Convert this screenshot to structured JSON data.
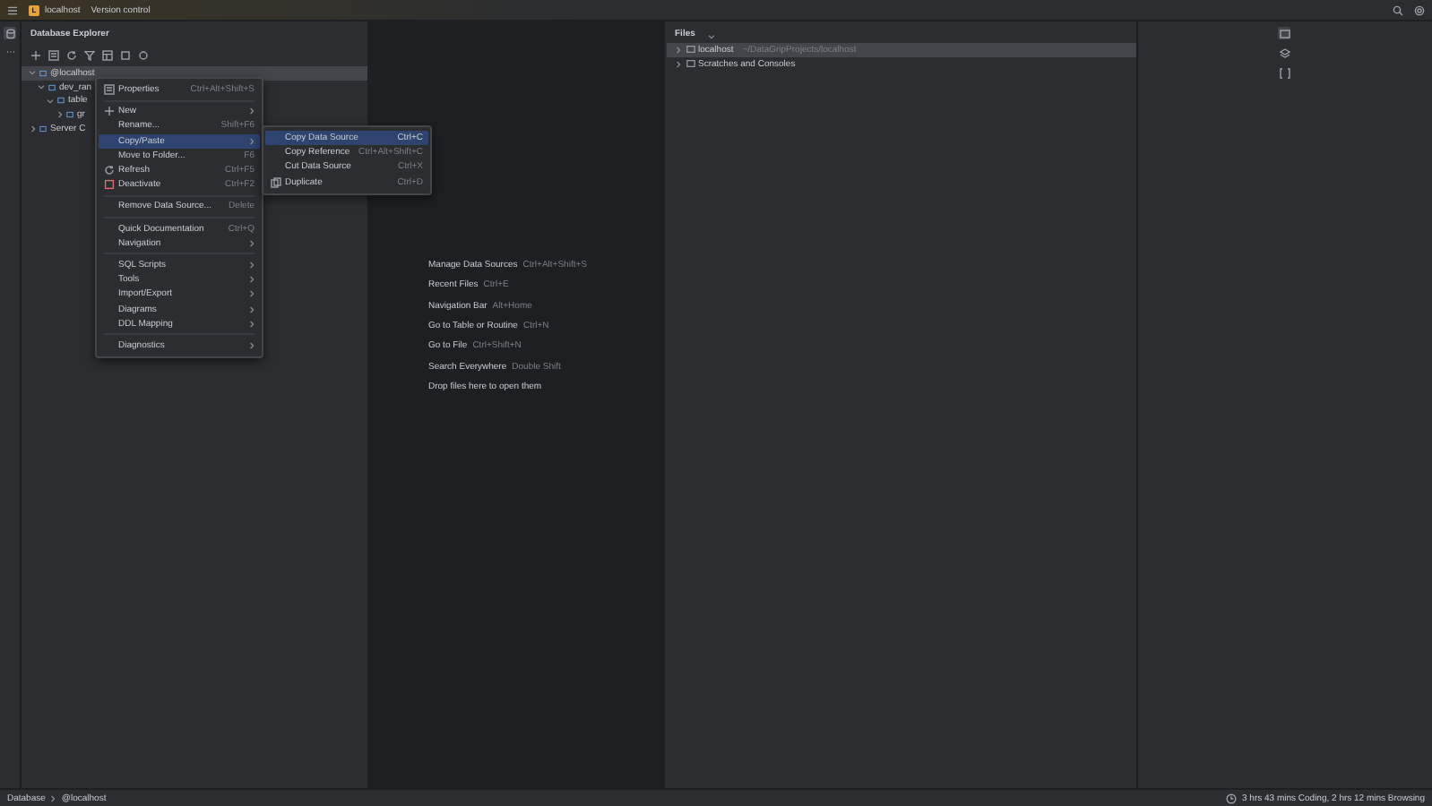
{
  "title_bar": {
    "project_badge": "L",
    "project": "localhost",
    "vcs": "Version control"
  },
  "explorer": {
    "title": "Database Explorer",
    "tree": [
      {
        "label": "@localhost",
        "selected": true,
        "expanded": true,
        "children": [
          {
            "label": "dev_ran",
            "selected": false,
            "expanded": true,
            "children": [
              {
                "label": "table",
                "selected": false,
                "expanded": true,
                "children": [
                  {
                    "label": "gr",
                    "selected": false,
                    "expanded": false
                  }
                ]
              }
            ]
          }
        ]
      },
      {
        "label": "Server C",
        "selected": false,
        "expanded": false
      }
    ]
  },
  "context_menu": [
    {
      "kind": "item",
      "label": "Properties",
      "shortcut": "Ctrl+Alt+Shift+S",
      "submenu": false,
      "selected": false
    },
    {
      "kind": "separator"
    },
    {
      "kind": "item",
      "label": "New",
      "submenu": true,
      "selected": false
    },
    {
      "kind": "item",
      "label": "Rename...",
      "shortcut": "Shift+F6",
      "submenu": false,
      "selected": false
    },
    {
      "kind": "item",
      "label": "Copy/Paste",
      "submenu": true,
      "selected": true
    },
    {
      "kind": "item",
      "label": "Move to Folder...",
      "shortcut": "F6",
      "submenu": false,
      "selected": false
    },
    {
      "kind": "item",
      "label": "Refresh",
      "shortcut": "Ctrl+F5",
      "submenu": false,
      "selected": false
    },
    {
      "kind": "item",
      "label": "Deactivate",
      "shortcut": "Ctrl+F2",
      "submenu": false,
      "selected": false
    },
    {
      "kind": "separator"
    },
    {
      "kind": "item",
      "label": "Remove Data Source...",
      "shortcut": "Delete",
      "submenu": false,
      "selected": false
    },
    {
      "kind": "separator"
    },
    {
      "kind": "item",
      "label": "Quick Documentation",
      "shortcut": "Ctrl+Q",
      "submenu": false,
      "selected": false
    },
    {
      "kind": "item",
      "label": "Navigation",
      "submenu": true,
      "selected": false
    },
    {
      "kind": "separator"
    },
    {
      "kind": "item",
      "label": "SQL Scripts",
      "submenu": true,
      "selected": false
    },
    {
      "kind": "item",
      "label": "Tools",
      "submenu": true,
      "selected": false
    },
    {
      "kind": "item",
      "label": "Import/Export",
      "submenu": true,
      "selected": false
    },
    {
      "kind": "item",
      "label": "Diagrams",
      "submenu": true,
      "selected": false
    },
    {
      "kind": "item",
      "label": "DDL Mapping",
      "submenu": true,
      "selected": false
    },
    {
      "kind": "separator"
    },
    {
      "kind": "item",
      "label": "Diagnostics",
      "submenu": true,
      "selected": false
    }
  ],
  "submenu": [
    {
      "label": "Copy Data Source",
      "shortcut": "Ctrl+C",
      "selected": true
    },
    {
      "label": "Copy Reference",
      "shortcut": "Ctrl+Alt+Shift+C",
      "selected": false
    },
    {
      "label": "Cut Data Source",
      "shortcut": "Ctrl+X",
      "selected": false
    },
    {
      "label": "Duplicate",
      "shortcut": "Ctrl+D",
      "selected": false
    }
  ],
  "editor_hints": [
    {
      "label": "Manage Data Sources",
      "shortcut": "Ctrl+Alt+Shift+S"
    },
    {
      "label": "Recent Files",
      "shortcut": "Ctrl+E"
    },
    {
      "label": "Navigation Bar",
      "shortcut": "Alt+Home"
    },
    {
      "label": "Go to Table or Routine",
      "shortcut": "Ctrl+N"
    },
    {
      "label": "Go to File",
      "shortcut": "Ctrl+Shift+N"
    },
    {
      "label": "Search Everywhere",
      "shortcut": "Double Shift"
    },
    {
      "label": "Drop files here to open them"
    }
  ],
  "files": {
    "title": "Files",
    "items": [
      {
        "label": "localhost",
        "path": "~/DataGripProjects/localhost",
        "selected": true
      },
      {
        "label": "Scratches and Consoles",
        "selected": false
      }
    ]
  },
  "status_bar": {
    "breadcrumbs": [
      "Database",
      "@localhost"
    ],
    "time_tracking": "3 hrs 43 mins Coding, 2 hrs 12 mins Browsing"
  }
}
